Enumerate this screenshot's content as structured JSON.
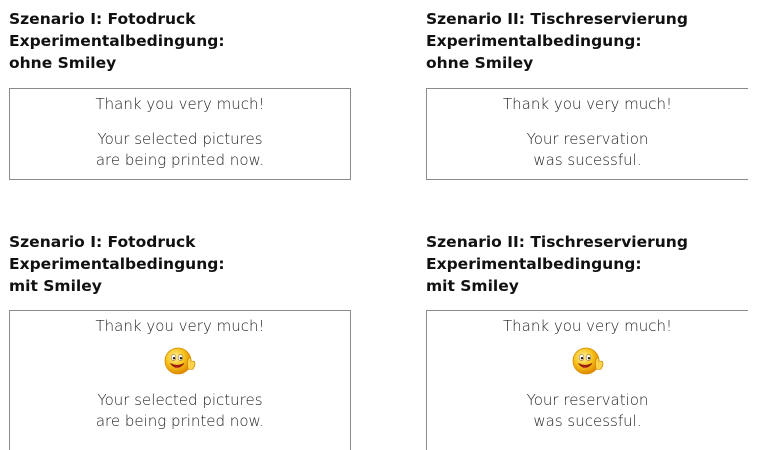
{
  "panels": [
    {
      "heading": [
        "Szenario I: Fotodruck",
        "Experimentalbedingung:",
        "ohne Smiley"
      ],
      "thanks": "Thank you very much!",
      "message": [
        "Your selected pictures",
        "are being printed now."
      ]
    },
    {
      "heading": [
        "Szenario II: Tischreservierung",
        "Experimentalbedingung:",
        "ohne Smiley"
      ],
      "thanks": "Thank you very much!",
      "message": [
        "Your reservation",
        "was sucessful."
      ]
    },
    {
      "heading": [
        "Szenario I: Fotodruck",
        "Experimentalbedingung:",
        "mit Smiley"
      ],
      "thanks": "Thank you very much!",
      "smiley_icon": "smiley-thumbs-up-icon",
      "message": [
        "Your selected pictures",
        "are being printed now."
      ]
    },
    {
      "heading": [
        "Szenario II: Tischreservierung",
        "Experimentalbedingung:",
        "mit Smiley"
      ],
      "thanks": "Thank you very much!",
      "smiley_icon": "smiley-thumbs-up-icon",
      "message": [
        "Your reservation",
        "was sucessful."
      ]
    }
  ],
  "colors": {
    "box_border": "#8a8a8a",
    "smiley_face": "#f7c21a",
    "smiley_outline": "#d98c00"
  }
}
